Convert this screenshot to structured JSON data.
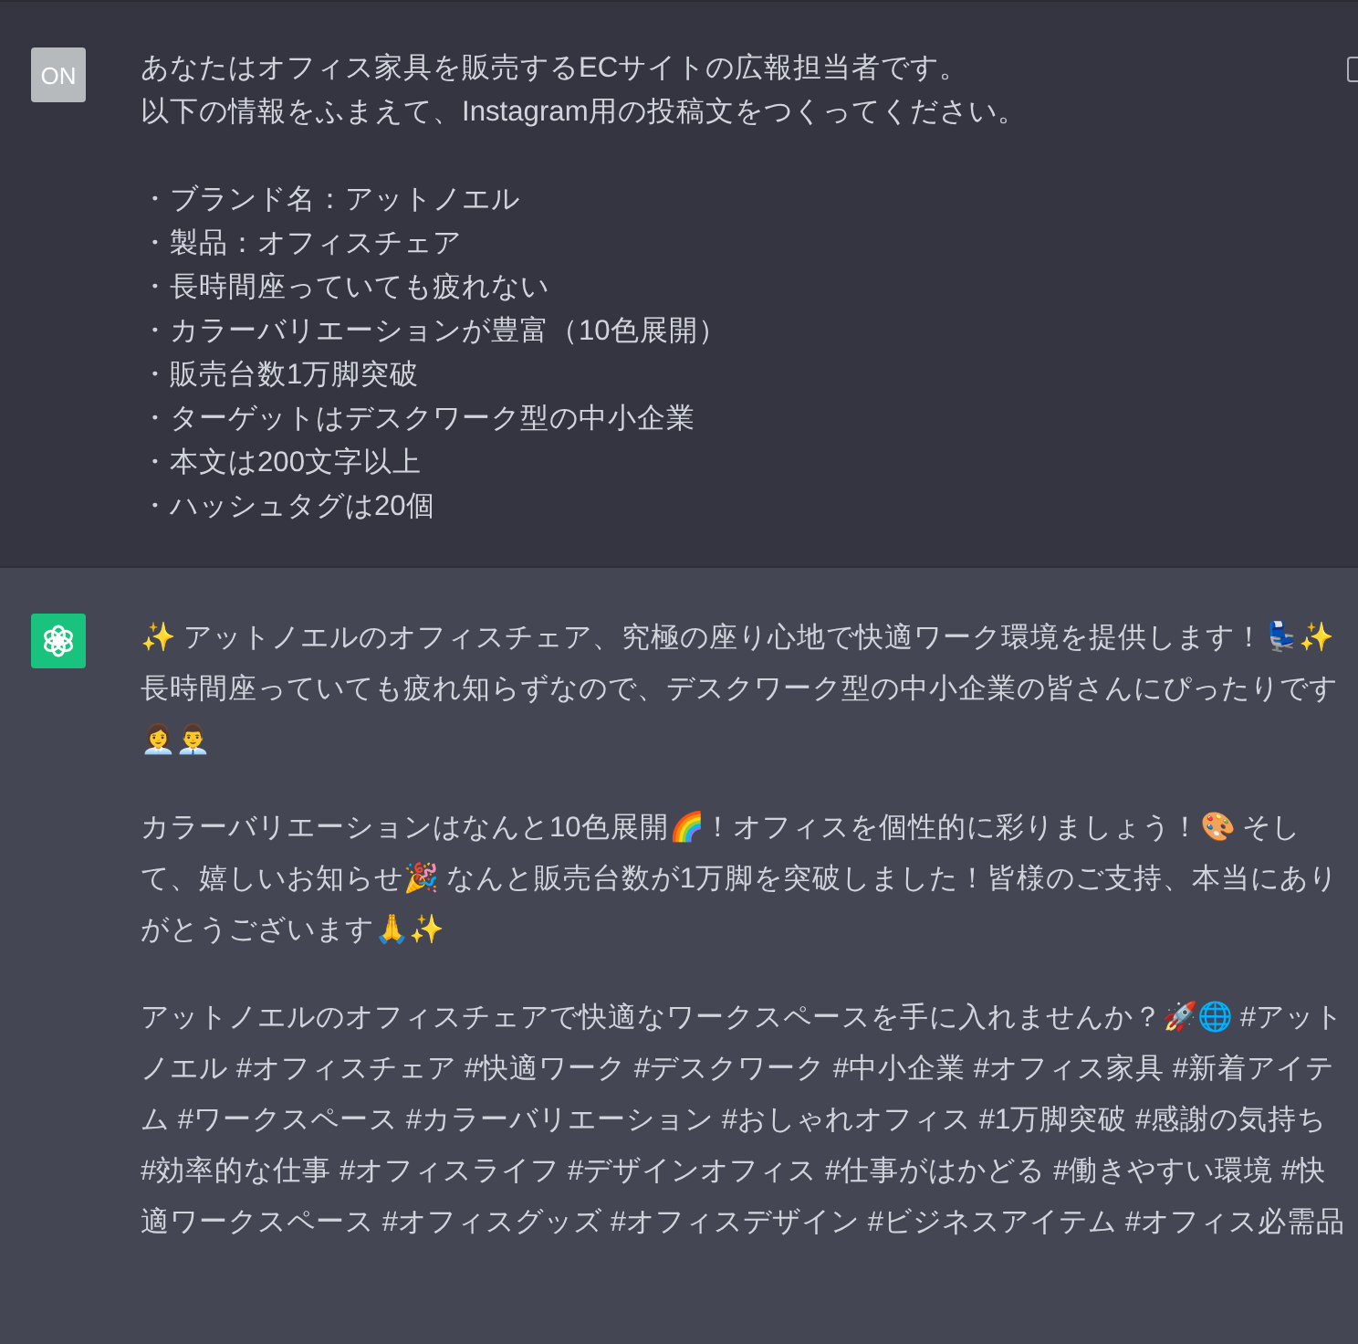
{
  "messages": [
    {
      "kind": "user",
      "avatar": "ON",
      "paragraphs": [
        [
          "あなたはオフィス家具を販売するECサイトの広報担当者です。",
          "以下の情報をふまえて、Instagram用の投稿文をつくってください。"
        ],
        [
          "・ブランド名：アットノエル",
          "・製品：オフィスチェア",
          "・長時間座っていても疲れない",
          "・カラーバリエーションが豊富（10色展開）",
          "・販売台数1万脚突破",
          "・ターゲットはデスクワーク型の中小企業",
          "・本文は200文字以上",
          "・ハッシュタグは20個"
        ]
      ]
    },
    {
      "kind": "assistant",
      "paragraphs": [
        [
          "✨ アットノエルのオフィスチェア、究極の座り心地で快適ワーク環境を提供します！💺✨長時間座っていても疲れ知らずなので、デスクワーク型の中小企業の皆さんにぴったりです👩‍💼👨‍💼"
        ],
        [
          "カラーバリエーションはなんと10色展開🌈！オフィスを個性的に彩りましょう！🎨 そして、嬉しいお知らせ🎉 なんと販売台数が1万脚を突破しました！皆様のご支持、本当にありがとうございます🙏✨"
        ],
        [
          "アットノエルのオフィスチェアで快適なワークスペースを手に入れませんか？🚀🌐 #アットノエル #オフィスチェア #快適ワーク #デスクワーク #中小企業 #オフィス家具 #新着アイテム #ワークスペース #カラーバリエーション #おしゃれオフィス #1万脚突破 #感謝の気持ち #効率的な仕事 #オフィスライフ #デザインオフィス #仕事がはかどる #働きやすい環境 #快適ワークスペース #オフィスグッズ #オフィスデザイン #ビジネスアイテム #オフィス必需品"
        ]
      ]
    }
  ]
}
